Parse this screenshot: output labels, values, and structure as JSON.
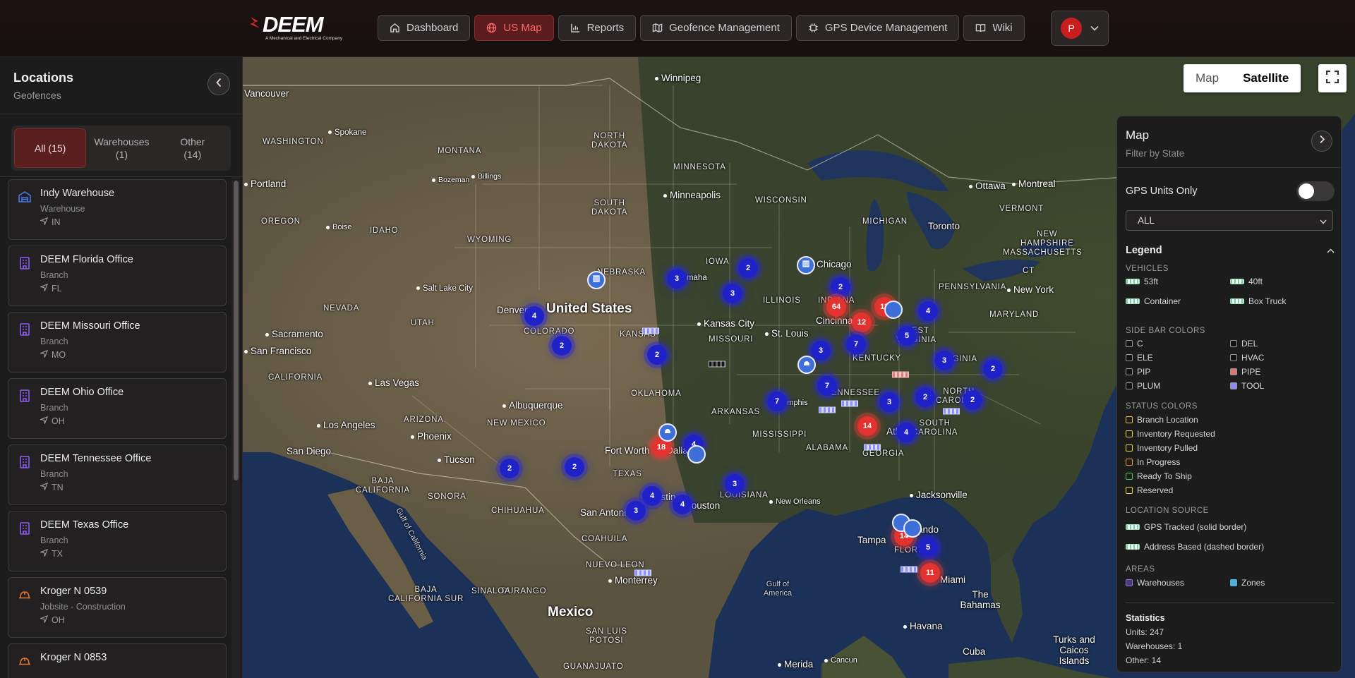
{
  "header": {
    "logo_text": "DEEM",
    "logo_tagline": "A Mechanical and Electrical Company",
    "nav": [
      {
        "label": "Dashboard",
        "icon": "home-icon"
      },
      {
        "label": "US Map",
        "icon": "globe-icon",
        "active": true
      },
      {
        "label": "Reports",
        "icon": "bar-chart-icon"
      },
      {
        "label": "Geofence Management",
        "icon": "map-icon"
      },
      {
        "label": "GPS Device Management",
        "icon": "chip-icon"
      },
      {
        "label": "Wiki",
        "icon": "book-icon"
      }
    ],
    "user_initial": "P"
  },
  "sidebar": {
    "title": "Locations",
    "subtitle": "Geofences",
    "tabs": [
      {
        "label": "All (15)",
        "active": true
      },
      {
        "label": "Warehouses\n(1)"
      },
      {
        "label": "Other\n(14)"
      }
    ],
    "locations": [
      {
        "name": "Indy Warehouse",
        "type": "Warehouse",
        "state": "IN",
        "icon": "warehouse-icon"
      },
      {
        "name": "DEEM Florida Office",
        "type": "Branch",
        "state": "FL",
        "icon": "office-building-icon"
      },
      {
        "name": "DEEM Missouri Office",
        "type": "Branch",
        "state": "MO",
        "icon": "office-building-icon"
      },
      {
        "name": "DEEM Ohio Office",
        "type": "Branch",
        "state": "OH",
        "icon": "office-building-icon"
      },
      {
        "name": "DEEM Tennessee Office",
        "type": "Branch",
        "state": "TN",
        "icon": "office-building-icon"
      },
      {
        "name": "DEEM Texas Office",
        "type": "Branch",
        "state": "TX",
        "icon": "office-building-icon"
      },
      {
        "name": "Kroger N 0539",
        "type": "Jobsite - Construction",
        "state": "OH",
        "icon": "hard-hat-icon"
      },
      {
        "name": "Kroger N 0853",
        "type": "",
        "state": "",
        "icon": "hard-hat-icon"
      }
    ]
  },
  "map": {
    "map_type_options": [
      "Map",
      "Satellite"
    ],
    "map_type_selected": "Satellite",
    "labels": {
      "cities": [
        "Vancouver",
        "Winnipeg",
        "Spokane",
        "Portland",
        "Bozeman",
        "Billings",
        "Minneapolis",
        "Ottawa",
        "Montreal",
        "Toronto",
        "Chicago",
        "Omaha",
        "Salt Lake City",
        "Boise",
        "Denver",
        "Sacramento",
        "San Francisco",
        "Las Vegas",
        "Kansas City",
        "St. Louis",
        "Cincinnati",
        "New York",
        "Los Angeles",
        "San Diego",
        "Phoenix",
        "Tucson",
        "Albuquerque",
        "Fort Worth",
        "Dallas",
        "Austin",
        "San Antonio",
        "Houston",
        "New Orleans",
        "Memphis",
        "Atlanta",
        "Jacksonville",
        "Tampa",
        "Orlando",
        "Miami",
        "Monterrey",
        "Havana",
        "Merida",
        "Cancun"
      ],
      "states": [
        "WASHINGTON",
        "OREGON",
        "IDAHO",
        "MONTANA",
        "WYOMING",
        "NORTH DAKOTA",
        "SOUTH DAKOTA",
        "MINNESOTA",
        "WISCONSIN",
        "MICHIGAN",
        "IOWA",
        "NEBRASKA",
        "NEVADA",
        "UTAH",
        "COLORADO",
        "KANSAS",
        "MISSOURI",
        "ILLINOIS",
        "INDIANA",
        "KENTUCKY",
        "CALIFORNIA",
        "ARIZONA",
        "NEW MEXICO",
        "OKLAHOMA",
        "ARKANSAS",
        "TENNESSEE",
        "TEXAS",
        "LOUISIANA",
        "MISSISSIPPI",
        "ALABAMA",
        "GEORGIA",
        "SOUTH CAROLINA",
        "NORTH CAROLINA",
        "VIRGINIA",
        "WEST VIRGINIA",
        "PENNSYLVANIA",
        "MARYLAND",
        "VERMONT",
        "NEW HAMPSHIRE",
        "MASSACHUSETTS",
        "CT",
        "FLORIDA",
        "BAJA CALIFORNIA",
        "SONORA",
        "CHIHUAHUA",
        "COAHUILA",
        "NUEVO LEON",
        "DURANGO",
        "SINALOA",
        "BAJA CALIFORNIA SUR",
        "SAN LUIS POTOSI",
        "GUANAJUATO"
      ],
      "countries": [
        "United States",
        "Mexico",
        "Cuba",
        "The Bahamas",
        "Turks and Caicos Islands"
      ],
      "water": [
        "Gulf of California",
        "Gulf of America"
      ]
    },
    "clusters": [
      {
        "count": "3",
        "color": "blue"
      },
      {
        "count": "2",
        "color": "blue"
      },
      {
        "count": "3",
        "color": "blue"
      },
      {
        "count": "4",
        "color": "blue"
      },
      {
        "count": "2",
        "color": "blue"
      },
      {
        "count": "2",
        "color": "blue"
      },
      {
        "count": "2",
        "color": "blue"
      },
      {
        "count": "64",
        "color": "red"
      },
      {
        "count": "11",
        "color": "red"
      },
      {
        "count": "12",
        "color": "red"
      },
      {
        "count": "4",
        "color": "blue"
      },
      {
        "count": "5",
        "color": "blue"
      },
      {
        "count": "3",
        "color": "blue"
      },
      {
        "count": "7",
        "color": "blue"
      },
      {
        "count": "3",
        "color": "blue"
      },
      {
        "count": "2",
        "color": "blue"
      },
      {
        "count": "7",
        "color": "blue"
      },
      {
        "count": "7",
        "color": "blue"
      },
      {
        "count": "3",
        "color": "blue"
      },
      {
        "count": "2",
        "color": "blue"
      },
      {
        "count": "2",
        "color": "blue"
      },
      {
        "count": "14",
        "color": "red"
      },
      {
        "count": "4",
        "color": "blue"
      },
      {
        "count": "18",
        "color": "red"
      },
      {
        "count": "4",
        "color": "blue"
      },
      {
        "count": "2",
        "color": "blue"
      },
      {
        "count": "2",
        "color": "blue"
      },
      {
        "count": "3",
        "color": "blue"
      },
      {
        "count": "4",
        "color": "blue"
      },
      {
        "count": "3",
        "color": "blue"
      },
      {
        "count": "4",
        "color": "blue"
      },
      {
        "count": "14",
        "color": "red"
      },
      {
        "count": "5",
        "color": "blue"
      },
      {
        "count": "11",
        "color": "red"
      }
    ]
  },
  "filter_panel": {
    "title": "Map",
    "subtitle": "Filter by State",
    "gps_units_only_label": "GPS Units Only",
    "gps_units_only": false,
    "state_select_value": "ALL",
    "legend_title": "Legend",
    "vehicles_heading": "VEHICLES",
    "vehicles": [
      "53ft",
      "40ft",
      "Container",
      "Box Truck"
    ],
    "side_bar_heading": "SIDE BAR COLORS",
    "side_bar_colors": [
      {
        "label": "C",
        "color": "#111111"
      },
      {
        "label": "DEL",
        "color": "#111111"
      },
      {
        "label": "ELE",
        "color": "#111111"
      },
      {
        "label": "HVAC",
        "color": "#111111"
      },
      {
        "label": "PIP",
        "color": "#111111"
      },
      {
        "label": "PIPE",
        "color": "#d97777"
      },
      {
        "label": "PLUM",
        "color": "#111111"
      },
      {
        "label": "TOOL",
        "color": "#8c8cf2"
      }
    ],
    "status_heading": "STATUS COLORS",
    "status_colors": [
      {
        "label": "Branch Location",
        "color": "#e7c23a"
      },
      {
        "label": "Inventory Requested",
        "color": "#e7dd3a"
      },
      {
        "label": "Inventory Pulled",
        "color": "#e7dd3a"
      },
      {
        "label": "In Progress",
        "color": "#e7a43a"
      },
      {
        "label": "Ready To Ship",
        "color": "#4fcf5a"
      },
      {
        "label": "Reserved",
        "color": "#e7dd3a"
      }
    ],
    "location_source_heading": "LOCATION SOURCE",
    "location_sources": [
      "GPS Tracked (solid border)",
      "Address Based (dashed border)"
    ],
    "areas_heading": "AREAS",
    "areas": [
      {
        "label": "Warehouses",
        "color": "#8c6cf2"
      },
      {
        "label": "Zones",
        "color": "#4fb0d8"
      }
    ],
    "statistics_title": "Statistics",
    "statistics": [
      "Units: 247",
      "Warehouses: 1",
      "Other: 14"
    ]
  }
}
